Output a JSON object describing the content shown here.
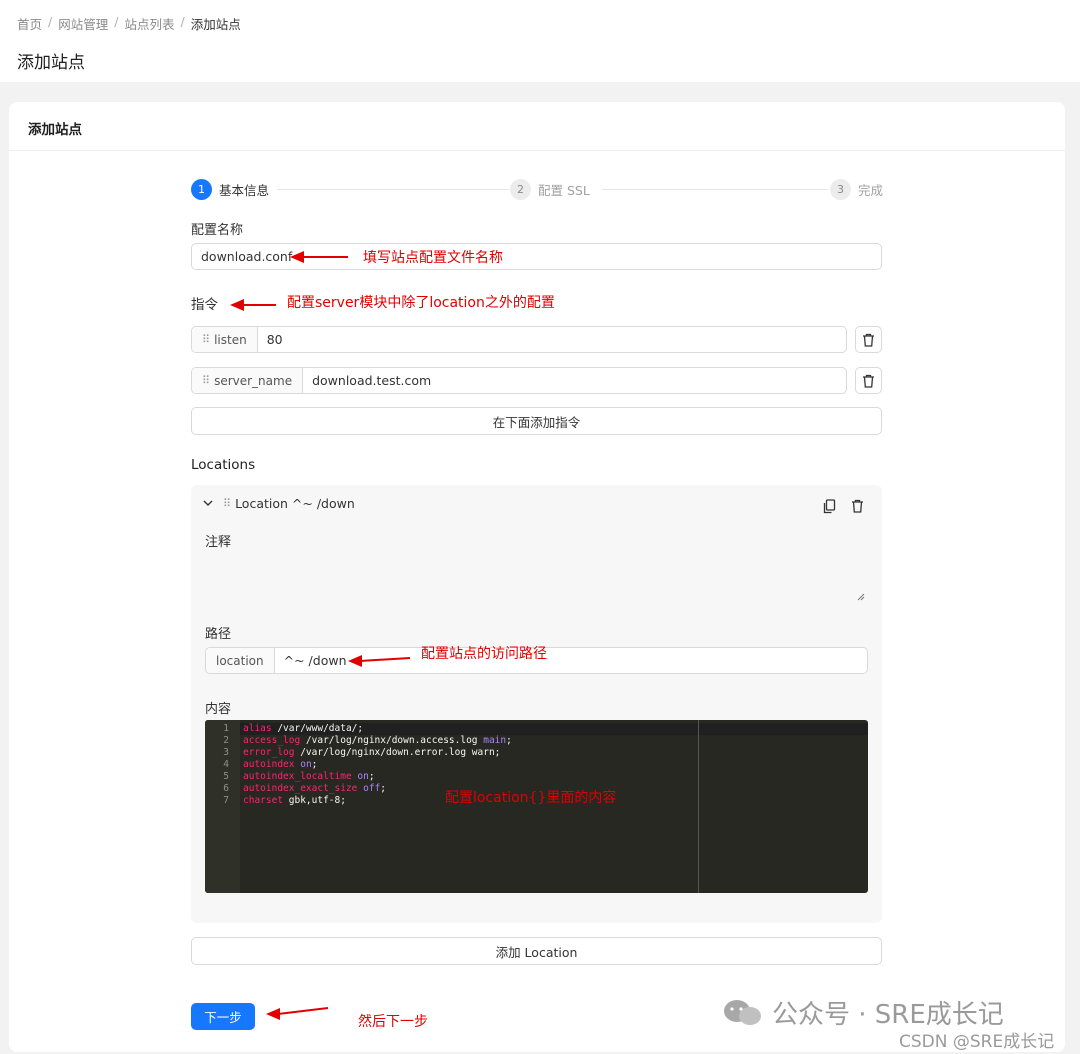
{
  "breadcrumb": [
    "首页",
    "网站管理",
    "站点列表",
    "添加站点"
  ],
  "page_title": "添加站点",
  "card_title": "添加站点",
  "steps": [
    {
      "num": "1",
      "label": "基本信息"
    },
    {
      "num": "2",
      "label": "配置 SSL"
    },
    {
      "num": "3",
      "label": "完成"
    }
  ],
  "config_name": {
    "label": "配置名称",
    "value": "download.conf"
  },
  "directives": {
    "title": "指令",
    "items": [
      {
        "name": "listen",
        "value": "80"
      },
      {
        "name": "server_name",
        "value": "download.test.com"
      }
    ],
    "add_label": "在下面添加指令"
  },
  "locations": {
    "title": "Locations",
    "item": {
      "header": "Location ^~ /down",
      "comment_label": "注释",
      "path_label": "路径",
      "path_addon": "location",
      "path_value": "^~ /down",
      "content_label": "内容",
      "code_lines": [
        {
          "n": "1",
          "k": "alias",
          "rest": " /var/www/data/;",
          "v": ""
        },
        {
          "n": "2",
          "k": "access_log",
          "rest": " /var/log/nginx/down.access.log ",
          "v": "main",
          "end": ";"
        },
        {
          "n": "3",
          "k": "error_log",
          "rest": " /var/log/nginx/down.error.log warn;",
          "v": ""
        },
        {
          "n": "4",
          "k": "autoindex",
          "rest": " ",
          "v": "on",
          "end": ";"
        },
        {
          "n": "5",
          "k": "autoindex_localtime",
          "rest": " ",
          "v": "on",
          "end": ";"
        },
        {
          "n": "6",
          "k": "autoindex_exact_size",
          "rest": " ",
          "v": "off",
          "end": ";"
        },
        {
          "n": "7",
          "k": "charset",
          "rest": " gbk,utf-8;",
          "v": ""
        }
      ]
    },
    "add_label": "添加 Location"
  },
  "next_label": "下一步",
  "annotations": {
    "a1": "填写站点配置文件名称",
    "a2": "配置server模块中除了location之外的配置",
    "a3": "配置站点的访问路径",
    "a4": "配置location{}里面的内容",
    "a5": "然后下一步"
  },
  "watermark": {
    "line1": "公众号 · SRE成长记",
    "line2": "CSDN @SRE成长记"
  },
  "colors": {
    "primary": "#1677ff",
    "annotation": "#e00000",
    "editor_bg": "#272822"
  }
}
